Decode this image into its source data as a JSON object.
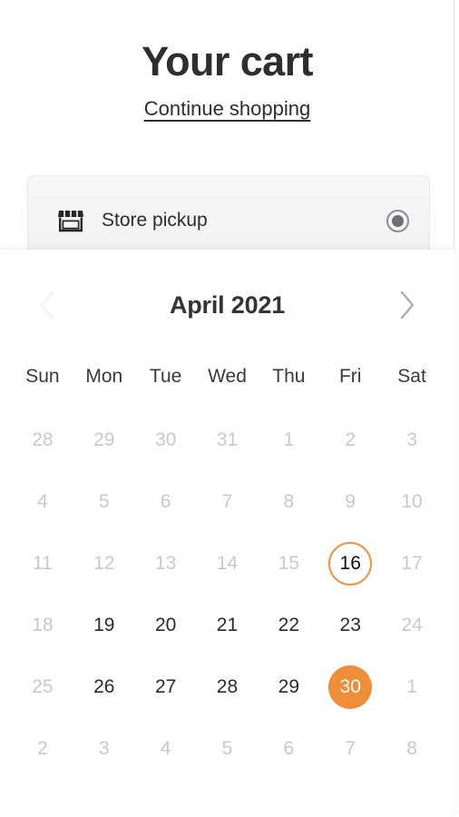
{
  "header": {
    "title": "Your cart",
    "continue_link": "Continue shopping"
  },
  "delivery_option": {
    "icon": "storefront-icon",
    "label": "Store pickup",
    "selected": true
  },
  "calendar": {
    "month_label": "April 2021",
    "prev_label": "‹",
    "next_label": "›",
    "prev_enabled": false,
    "next_enabled": true,
    "weekdays": [
      "Sun",
      "Mon",
      "Tue",
      "Wed",
      "Thu",
      "Fri",
      "Sat"
    ],
    "accent_color": "#ee8e38",
    "today_ring_color": "#f0923c",
    "disabled_color": "#c9c9c9",
    "enabled_color": "#2b2b2b",
    "days": [
      {
        "n": "28",
        "state": "disabled"
      },
      {
        "n": "29",
        "state": "disabled"
      },
      {
        "n": "30",
        "state": "disabled"
      },
      {
        "n": "31",
        "state": "disabled"
      },
      {
        "n": "1",
        "state": "disabled"
      },
      {
        "n": "2",
        "state": "disabled"
      },
      {
        "n": "3",
        "state": "disabled"
      },
      {
        "n": "4",
        "state": "disabled"
      },
      {
        "n": "5",
        "state": "disabled"
      },
      {
        "n": "6",
        "state": "disabled"
      },
      {
        "n": "7",
        "state": "disabled"
      },
      {
        "n": "8",
        "state": "disabled"
      },
      {
        "n": "9",
        "state": "disabled"
      },
      {
        "n": "10",
        "state": "disabled"
      },
      {
        "n": "11",
        "state": "disabled"
      },
      {
        "n": "12",
        "state": "disabled"
      },
      {
        "n": "13",
        "state": "disabled"
      },
      {
        "n": "14",
        "state": "disabled"
      },
      {
        "n": "15",
        "state": "disabled"
      },
      {
        "n": "16",
        "state": "today"
      },
      {
        "n": "17",
        "state": "disabled"
      },
      {
        "n": "18",
        "state": "disabled"
      },
      {
        "n": "19",
        "state": "enabled"
      },
      {
        "n": "20",
        "state": "enabled"
      },
      {
        "n": "21",
        "state": "enabled"
      },
      {
        "n": "22",
        "state": "enabled"
      },
      {
        "n": "23",
        "state": "enabled"
      },
      {
        "n": "24",
        "state": "disabled"
      },
      {
        "n": "25",
        "state": "disabled"
      },
      {
        "n": "26",
        "state": "enabled"
      },
      {
        "n": "27",
        "state": "enabled"
      },
      {
        "n": "28",
        "state": "enabled"
      },
      {
        "n": "29",
        "state": "enabled"
      },
      {
        "n": "30",
        "state": "selected"
      },
      {
        "n": "1",
        "state": "disabled"
      },
      {
        "n": "2",
        "state": "disabled"
      },
      {
        "n": "3",
        "state": "disabled"
      },
      {
        "n": "4",
        "state": "disabled"
      },
      {
        "n": "5",
        "state": "disabled"
      },
      {
        "n": "6",
        "state": "disabled"
      },
      {
        "n": "7",
        "state": "disabled"
      },
      {
        "n": "8",
        "state": "disabled"
      }
    ]
  }
}
